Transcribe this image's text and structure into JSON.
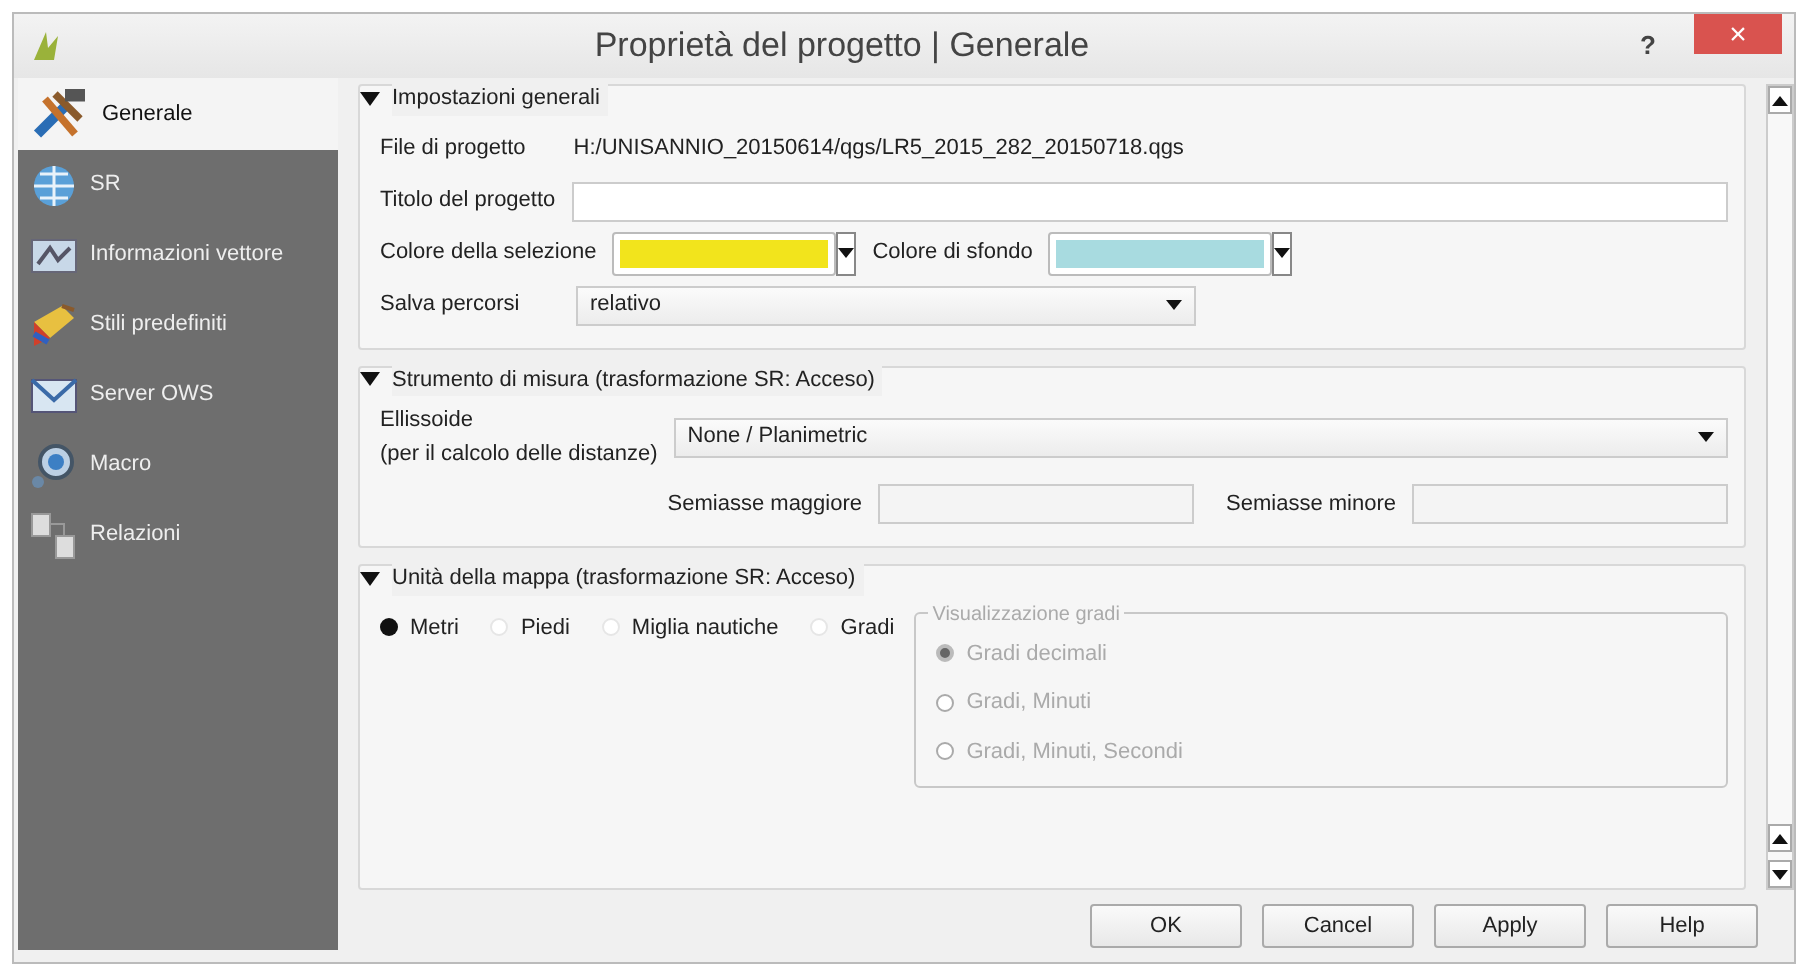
{
  "window": {
    "title": "Proprietà del progetto | Generale",
    "help": "?",
    "close": "×"
  },
  "sidebar": {
    "items": [
      {
        "label": "Generale",
        "selected": true
      },
      {
        "label": "SR",
        "selected": false
      },
      {
        "label": "Informazioni vettore",
        "selected": false
      },
      {
        "label": "Stili predefiniti",
        "selected": false
      },
      {
        "label": "Server OWS",
        "selected": false
      },
      {
        "label": "Macro",
        "selected": false
      },
      {
        "label": "Relazioni",
        "selected": false
      }
    ]
  },
  "general": {
    "title": "Impostazioni generali",
    "expanded": true,
    "file_label": "File di progetto",
    "file_value": "H:/UNISANNIO_20150614/qgs/LR5_2015_282_20150718.qgs",
    "title_label": "Titolo del progetto",
    "selection_color_label": "Colore della selezione",
    "background_color_label": "Colore di sfondo",
    "paths_label": "Salva percorsi",
    "paths_value": "relativo"
  },
  "measure": {
    "title": "Strumento di misura (trasformazione SR: Acceso)",
    "expanded": true,
    "ellipsoid_label": "Ellissoide",
    "ellipsoid_label_2": "(per il calcolo  delle distanze)",
    "ellipsoid_value": "None / Planimetric",
    "major_label": "Semiasse maggiore",
    "minor_label": "Semiasse minore"
  },
  "units": {
    "title": "Unità della mappa (trasformazione SR: Acceso)",
    "expanded": true,
    "options": [
      {
        "label": "Metri",
        "selected": true
      },
      {
        "label": "Piedi",
        "selected": false
      },
      {
        "label": "Miglia nautiche",
        "selected": false
      },
      {
        "label": "Gradi",
        "selected": false
      }
    ],
    "degrees": {
      "title": "Visualizzazione gradi",
      "disabled": true,
      "options": [
        {
          "label": "Gradi decimali",
          "selected": true
        },
        {
          "label": "Gradi, Minuti",
          "selected": false
        },
        {
          "label": "Gradi, Minuti, Secondi",
          "selected": false
        }
      ]
    }
  },
  "buttons": [
    "OK",
    "Cancel",
    "Apply",
    "Help"
  ]
}
